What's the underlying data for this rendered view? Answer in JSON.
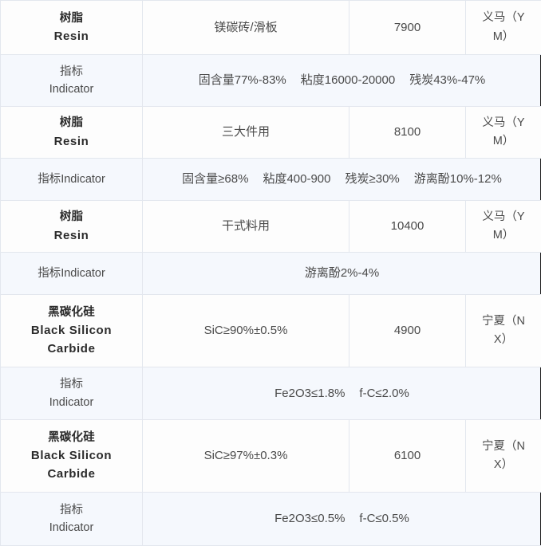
{
  "table": {
    "columns": [
      "name",
      "usage",
      "price",
      "origin"
    ],
    "rows": [
      {
        "kind": "product",
        "name_cn": "树脂",
        "name_en": "Resin",
        "usage": "镁碳砖/滑板",
        "price": "7900",
        "origin_line1": "义马（Y",
        "origin_line2": "M）"
      },
      {
        "kind": "indicator",
        "label_cn": "指标",
        "label_en": "Indicator",
        "label_inline": false,
        "specs": [
          "固含量77%-83%",
          "粘度16000-20000",
          "残炭43%-47%"
        ]
      },
      {
        "kind": "product",
        "name_cn": "树脂",
        "name_en": "Resin",
        "usage": "三大件用",
        "price": "8100",
        "origin_line1": "义马（Y",
        "origin_line2": "M）"
      },
      {
        "kind": "indicator",
        "label_cn": "指标",
        "label_en": "Indicator",
        "label_inline": true,
        "specs": [
          "固含量≥68%",
          "粘度400-900",
          "残炭≥30%",
          "游离酚10%-12%"
        ]
      },
      {
        "kind": "product",
        "name_cn": "树脂",
        "name_en": "Resin",
        "usage": "干式料用",
        "price": "10400",
        "origin_line1": "义马（Y",
        "origin_line2": "M）"
      },
      {
        "kind": "indicator",
        "label_cn": "指标",
        "label_en": "Indicator",
        "label_inline": true,
        "specs": [
          "游离酚2%-4%"
        ]
      },
      {
        "kind": "product",
        "name_cn": "黑碳化硅",
        "name_en": "Black Silicon Carbide",
        "usage": "SiC≥90%±0.5%",
        "price": "4900",
        "origin_line1": "宁夏（N",
        "origin_line2": "X）"
      },
      {
        "kind": "indicator",
        "label_cn": "指标",
        "label_en": "Indicator",
        "label_inline": false,
        "specs": [
          "Fe2O3≤1.8%",
          "f-C≤2.0%"
        ]
      },
      {
        "kind": "product",
        "name_cn": "黑碳化硅",
        "name_en": "Black Silicon Carbide",
        "usage": "SiC≥97%±0.3%",
        "price": "6100",
        "origin_line1": "宁夏（N",
        "origin_line2": "X）"
      },
      {
        "kind": "indicator",
        "label_cn": "指标",
        "label_en": "Indicator",
        "label_inline": false,
        "specs": [
          "Fe2O3≤0.5%",
          "f-C≤0.5%"
        ]
      }
    ]
  },
  "colors": {
    "border": "#e3e7ee",
    "product_row_bg": "#fdfdfd",
    "indicator_row_bg": "#f5f8fd",
    "text": "#4a4a4a",
    "heading_text": "#2b2b2b",
    "edge_marker": "#1b1b1b"
  }
}
